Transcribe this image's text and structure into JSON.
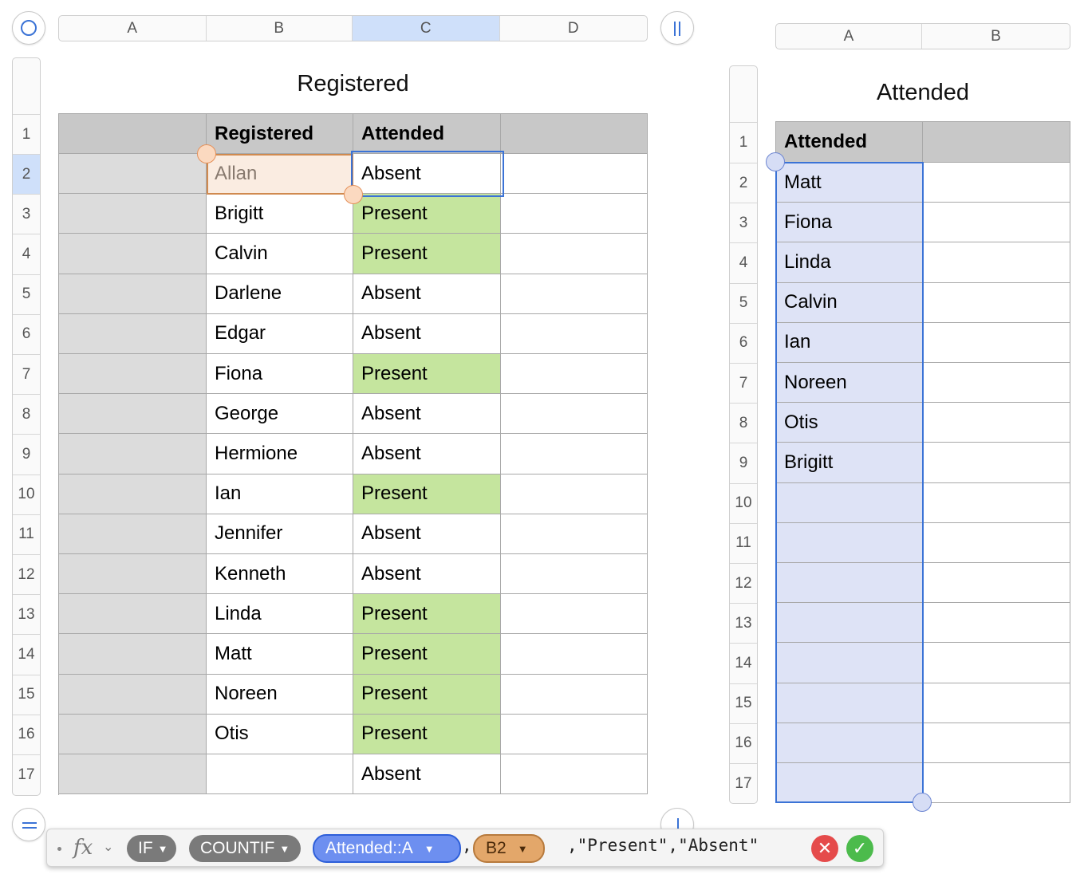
{
  "left_table": {
    "title": "Registered",
    "columns": [
      "A",
      "B",
      "C",
      "D"
    ],
    "selected_column": "C",
    "row_numbers": [
      "1",
      "2",
      "3",
      "4",
      "5",
      "6",
      "7",
      "8",
      "9",
      "10",
      "11",
      "12",
      "13",
      "14",
      "15",
      "16",
      "17"
    ],
    "selected_row": "2",
    "header_row": [
      "",
      "Registered",
      "Attended",
      ""
    ],
    "rows": [
      {
        "name": "Allan",
        "status": "Absent"
      },
      {
        "name": "Brigitt",
        "status": "Present"
      },
      {
        "name": "Calvin",
        "status": "Present"
      },
      {
        "name": "Darlene",
        "status": "Absent"
      },
      {
        "name": "Edgar",
        "status": "Absent"
      },
      {
        "name": "Fiona",
        "status": "Present"
      },
      {
        "name": "George",
        "status": "Absent"
      },
      {
        "name": "Hermione",
        "status": "Absent"
      },
      {
        "name": "Ian",
        "status": "Present"
      },
      {
        "name": "Jennifer",
        "status": "Absent"
      },
      {
        "name": "Kenneth",
        "status": "Absent"
      },
      {
        "name": "Linda",
        "status": "Present"
      },
      {
        "name": "Matt",
        "status": "Present"
      },
      {
        "name": "Noreen",
        "status": "Present"
      },
      {
        "name": "Otis",
        "status": "Present"
      },
      {
        "name": "",
        "status": "Absent"
      }
    ]
  },
  "right_table": {
    "title": "Attended",
    "columns": [
      "A",
      "B"
    ],
    "row_numbers": [
      "1",
      "2",
      "3",
      "4",
      "5",
      "6",
      "7",
      "8",
      "9",
      "10",
      "11",
      "12",
      "13",
      "14",
      "15",
      "16",
      "17"
    ],
    "header_row": [
      "Attended",
      ""
    ],
    "names": [
      "Matt",
      "Fiona",
      "Linda",
      "Calvin",
      "Ian",
      "Noreen",
      "Otis",
      "Brigitt",
      "",
      "",
      "",
      "",
      "",
      "",
      "",
      ""
    ]
  },
  "formula_bar": {
    "fx_label": "fx",
    "chevron": "⌄",
    "tokens": [
      "IF",
      "COUNTIF",
      "Attended::A",
      "B2"
    ],
    "separator": ",",
    "tail": ",\"Present\",\"Absent\"",
    "cancel_symbol": "✕",
    "accept_symbol": "✓"
  },
  "colors": {
    "present_fill": "#c5e59e",
    "selection_blue": "#3b73d6",
    "reference_orange": "#d08a4f",
    "highlight_fill": "#dee3f6"
  },
  "icons": {
    "select_all": "circle-icon",
    "column_resize": "pause-icon",
    "row_resize": "equals-icon",
    "formula_cancel": "close-icon",
    "formula_accept": "checkmark-icon"
  }
}
